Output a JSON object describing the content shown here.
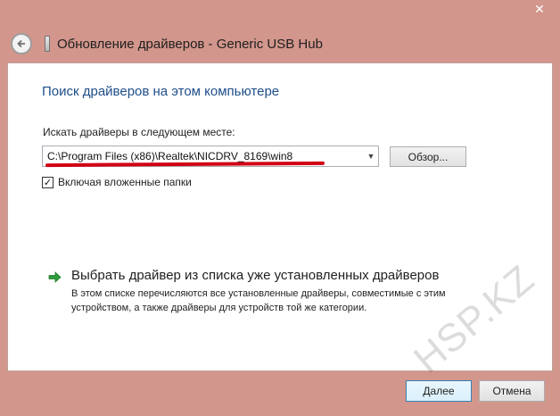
{
  "window": {
    "title": "Обновление драйверов - Generic USB Hub",
    "close_glyph": "✕"
  },
  "main": {
    "heading": "Поиск драйверов на этом компьютере",
    "search_label": "Искать драйверы в следующем месте:",
    "path_value": "C:\\Program Files (x86)\\Realtek\\NICDRV_8169\\win8",
    "browse_label": "Обзор...",
    "include_subfolders_label": "Включая вложенные папки",
    "include_subfolders_checked": true,
    "pick_option_title": "Выбрать драйвер из списка уже установленных драйверов",
    "pick_option_desc": "В этом списке перечисляются все установленные драйверы, совместимые с этим устройством, а также драйверы для устройств той же категории."
  },
  "footer": {
    "next_label": "Далее",
    "cancel_label": "Отмена"
  },
  "watermark": "HSP.KZ",
  "colors": {
    "frame": "#d2968c",
    "heading": "#1e4e8a",
    "annotation_underline": "#d10014",
    "arrow": "#2e9b3c"
  }
}
